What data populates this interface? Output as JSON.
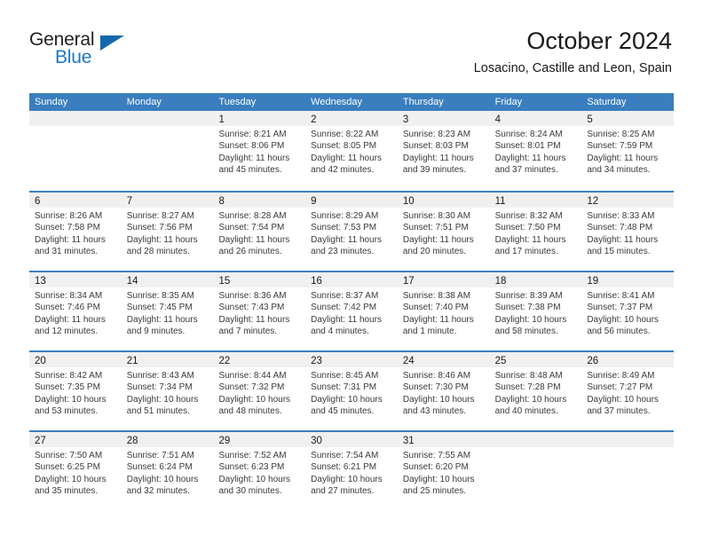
{
  "logo": {
    "name": "General Blue",
    "word_one": "General",
    "word_two": "Blue",
    "triangle_color": "#1668ad",
    "blue_text_color": "#1f77c2"
  },
  "header": {
    "title": "October 2024",
    "location": "Losacino, Castille and Leon, Spain"
  },
  "theme": {
    "header_row_bg": "#3a7ebf",
    "day_band_bg": "#f0f0f0",
    "row_separator": "#3a7ebf"
  },
  "weekdays": [
    "Sunday",
    "Monday",
    "Tuesday",
    "Wednesday",
    "Thursday",
    "Friday",
    "Saturday"
  ],
  "weeks": [
    [
      {
        "day": "",
        "empty": true
      },
      {
        "day": "",
        "empty": true
      },
      {
        "day": "1",
        "sunrise": "Sunrise: 8:21 AM",
        "sunset": "Sunset: 8:06 PM",
        "daylight_1": "Daylight: 11 hours",
        "daylight_2": "and 45 minutes."
      },
      {
        "day": "2",
        "sunrise": "Sunrise: 8:22 AM",
        "sunset": "Sunset: 8:05 PM",
        "daylight_1": "Daylight: 11 hours",
        "daylight_2": "and 42 minutes."
      },
      {
        "day": "3",
        "sunrise": "Sunrise: 8:23 AM",
        "sunset": "Sunset: 8:03 PM",
        "daylight_1": "Daylight: 11 hours",
        "daylight_2": "and 39 minutes."
      },
      {
        "day": "4",
        "sunrise": "Sunrise: 8:24 AM",
        "sunset": "Sunset: 8:01 PM",
        "daylight_1": "Daylight: 11 hours",
        "daylight_2": "and 37 minutes."
      },
      {
        "day": "5",
        "sunrise": "Sunrise: 8:25 AM",
        "sunset": "Sunset: 7:59 PM",
        "daylight_1": "Daylight: 11 hours",
        "daylight_2": "and 34 minutes."
      }
    ],
    [
      {
        "day": "6",
        "sunrise": "Sunrise: 8:26 AM",
        "sunset": "Sunset: 7:58 PM",
        "daylight_1": "Daylight: 11 hours",
        "daylight_2": "and 31 minutes."
      },
      {
        "day": "7",
        "sunrise": "Sunrise: 8:27 AM",
        "sunset": "Sunset: 7:56 PM",
        "daylight_1": "Daylight: 11 hours",
        "daylight_2": "and 28 minutes."
      },
      {
        "day": "8",
        "sunrise": "Sunrise: 8:28 AM",
        "sunset": "Sunset: 7:54 PM",
        "daylight_1": "Daylight: 11 hours",
        "daylight_2": "and 26 minutes."
      },
      {
        "day": "9",
        "sunrise": "Sunrise: 8:29 AM",
        "sunset": "Sunset: 7:53 PM",
        "daylight_1": "Daylight: 11 hours",
        "daylight_2": "and 23 minutes."
      },
      {
        "day": "10",
        "sunrise": "Sunrise: 8:30 AM",
        "sunset": "Sunset: 7:51 PM",
        "daylight_1": "Daylight: 11 hours",
        "daylight_2": "and 20 minutes."
      },
      {
        "day": "11",
        "sunrise": "Sunrise: 8:32 AM",
        "sunset": "Sunset: 7:50 PM",
        "daylight_1": "Daylight: 11 hours",
        "daylight_2": "and 17 minutes."
      },
      {
        "day": "12",
        "sunrise": "Sunrise: 8:33 AM",
        "sunset": "Sunset: 7:48 PM",
        "daylight_1": "Daylight: 11 hours",
        "daylight_2": "and 15 minutes."
      }
    ],
    [
      {
        "day": "13",
        "sunrise": "Sunrise: 8:34 AM",
        "sunset": "Sunset: 7:46 PM",
        "daylight_1": "Daylight: 11 hours",
        "daylight_2": "and 12 minutes."
      },
      {
        "day": "14",
        "sunrise": "Sunrise: 8:35 AM",
        "sunset": "Sunset: 7:45 PM",
        "daylight_1": "Daylight: 11 hours",
        "daylight_2": "and 9 minutes."
      },
      {
        "day": "15",
        "sunrise": "Sunrise: 8:36 AM",
        "sunset": "Sunset: 7:43 PM",
        "daylight_1": "Daylight: 11 hours",
        "daylight_2": "and 7 minutes."
      },
      {
        "day": "16",
        "sunrise": "Sunrise: 8:37 AM",
        "sunset": "Sunset: 7:42 PM",
        "daylight_1": "Daylight: 11 hours",
        "daylight_2": "and 4 minutes."
      },
      {
        "day": "17",
        "sunrise": "Sunrise: 8:38 AM",
        "sunset": "Sunset: 7:40 PM",
        "daylight_1": "Daylight: 11 hours",
        "daylight_2": "and 1 minute."
      },
      {
        "day": "18",
        "sunrise": "Sunrise: 8:39 AM",
        "sunset": "Sunset: 7:38 PM",
        "daylight_1": "Daylight: 10 hours",
        "daylight_2": "and 58 minutes."
      },
      {
        "day": "19",
        "sunrise": "Sunrise: 8:41 AM",
        "sunset": "Sunset: 7:37 PM",
        "daylight_1": "Daylight: 10 hours",
        "daylight_2": "and 56 minutes."
      }
    ],
    [
      {
        "day": "20",
        "sunrise": "Sunrise: 8:42 AM",
        "sunset": "Sunset: 7:35 PM",
        "daylight_1": "Daylight: 10 hours",
        "daylight_2": "and 53 minutes."
      },
      {
        "day": "21",
        "sunrise": "Sunrise: 8:43 AM",
        "sunset": "Sunset: 7:34 PM",
        "daylight_1": "Daylight: 10 hours",
        "daylight_2": "and 51 minutes."
      },
      {
        "day": "22",
        "sunrise": "Sunrise: 8:44 AM",
        "sunset": "Sunset: 7:32 PM",
        "daylight_1": "Daylight: 10 hours",
        "daylight_2": "and 48 minutes."
      },
      {
        "day": "23",
        "sunrise": "Sunrise: 8:45 AM",
        "sunset": "Sunset: 7:31 PM",
        "daylight_1": "Daylight: 10 hours",
        "daylight_2": "and 45 minutes."
      },
      {
        "day": "24",
        "sunrise": "Sunrise: 8:46 AM",
        "sunset": "Sunset: 7:30 PM",
        "daylight_1": "Daylight: 10 hours",
        "daylight_2": "and 43 minutes."
      },
      {
        "day": "25",
        "sunrise": "Sunrise: 8:48 AM",
        "sunset": "Sunset: 7:28 PM",
        "daylight_1": "Daylight: 10 hours",
        "daylight_2": "and 40 minutes."
      },
      {
        "day": "26",
        "sunrise": "Sunrise: 8:49 AM",
        "sunset": "Sunset: 7:27 PM",
        "daylight_1": "Daylight: 10 hours",
        "daylight_2": "and 37 minutes."
      }
    ],
    [
      {
        "day": "27",
        "sunrise": "Sunrise: 7:50 AM",
        "sunset": "Sunset: 6:25 PM",
        "daylight_1": "Daylight: 10 hours",
        "daylight_2": "and 35 minutes."
      },
      {
        "day": "28",
        "sunrise": "Sunrise: 7:51 AM",
        "sunset": "Sunset: 6:24 PM",
        "daylight_1": "Daylight: 10 hours",
        "daylight_2": "and 32 minutes."
      },
      {
        "day": "29",
        "sunrise": "Sunrise: 7:52 AM",
        "sunset": "Sunset: 6:23 PM",
        "daylight_1": "Daylight: 10 hours",
        "daylight_2": "and 30 minutes."
      },
      {
        "day": "30",
        "sunrise": "Sunrise: 7:54 AM",
        "sunset": "Sunset: 6:21 PM",
        "daylight_1": "Daylight: 10 hours",
        "daylight_2": "and 27 minutes."
      },
      {
        "day": "31",
        "sunrise": "Sunrise: 7:55 AM",
        "sunset": "Sunset: 6:20 PM",
        "daylight_1": "Daylight: 10 hours",
        "daylight_2": "and 25 minutes."
      },
      {
        "day": "",
        "empty": true
      },
      {
        "day": "",
        "empty": true
      }
    ]
  ]
}
